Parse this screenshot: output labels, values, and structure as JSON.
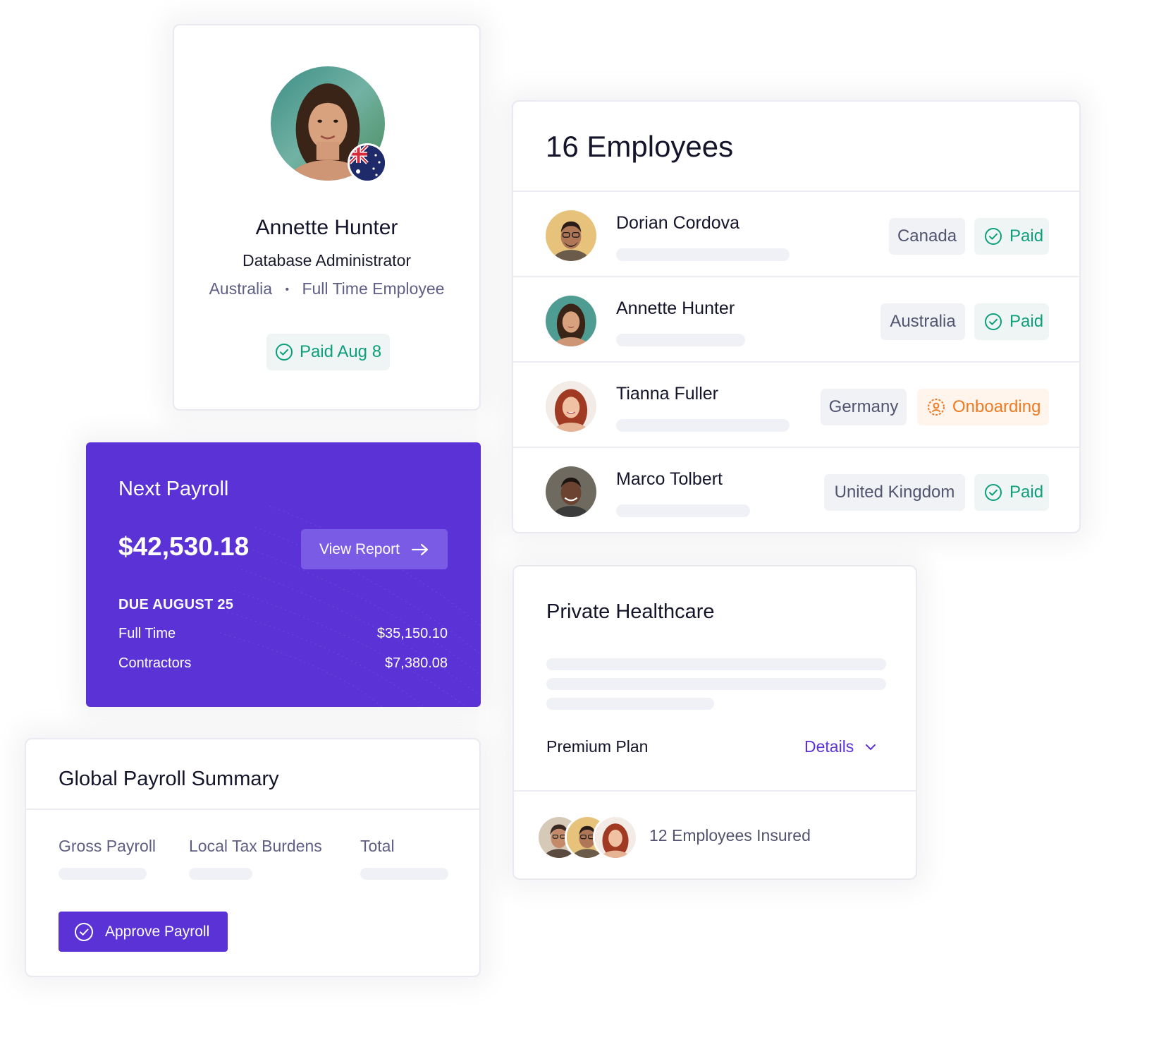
{
  "profile": {
    "name": "Annette Hunter",
    "role": "Database Administrator",
    "country": "Australia",
    "separator": "•",
    "employment_type": "Full Time Employee",
    "status": "Paid Aug 8",
    "flag_icon": "australia-flag-icon"
  },
  "employees": {
    "title": "16 Employees",
    "rows": [
      {
        "name": "Dorian Cordova",
        "country": "Canada",
        "status": "Paid",
        "status_type": "paid"
      },
      {
        "name": "Annette Hunter",
        "country": "Australia",
        "status": "Paid",
        "status_type": "paid"
      },
      {
        "name": "Tianna Fuller",
        "country": "Germany",
        "status": "Onboarding",
        "status_type": "onboarding"
      },
      {
        "name": "Marco Tolbert",
        "country": "United Kingdom",
        "status": "Paid",
        "status_type": "paid"
      }
    ]
  },
  "payroll": {
    "title": "Next Payroll",
    "amount": "$42,530.18",
    "view_report_label": "View Report",
    "due": "DUE AUGUST 25",
    "lines": [
      {
        "label": "Full Time",
        "value": "$35,150.10"
      },
      {
        "label": "Contractors",
        "value": "$7,380.08"
      }
    ]
  },
  "summary": {
    "title": "Global Payroll Summary",
    "columns": [
      "Gross Payroll",
      "Local Tax Burdens",
      "Total"
    ],
    "approve_label": "Approve Payroll"
  },
  "healthcare": {
    "title": "Private Healthcare",
    "plan": "Premium Plan",
    "details_label": "Details",
    "insured": "12 Employees Insured"
  },
  "colors": {
    "accent": "#5b32d6",
    "paid_green": "#0c9f7c",
    "onboarding_orange": "#ef7a22",
    "link_purple": "#5b32d6"
  }
}
